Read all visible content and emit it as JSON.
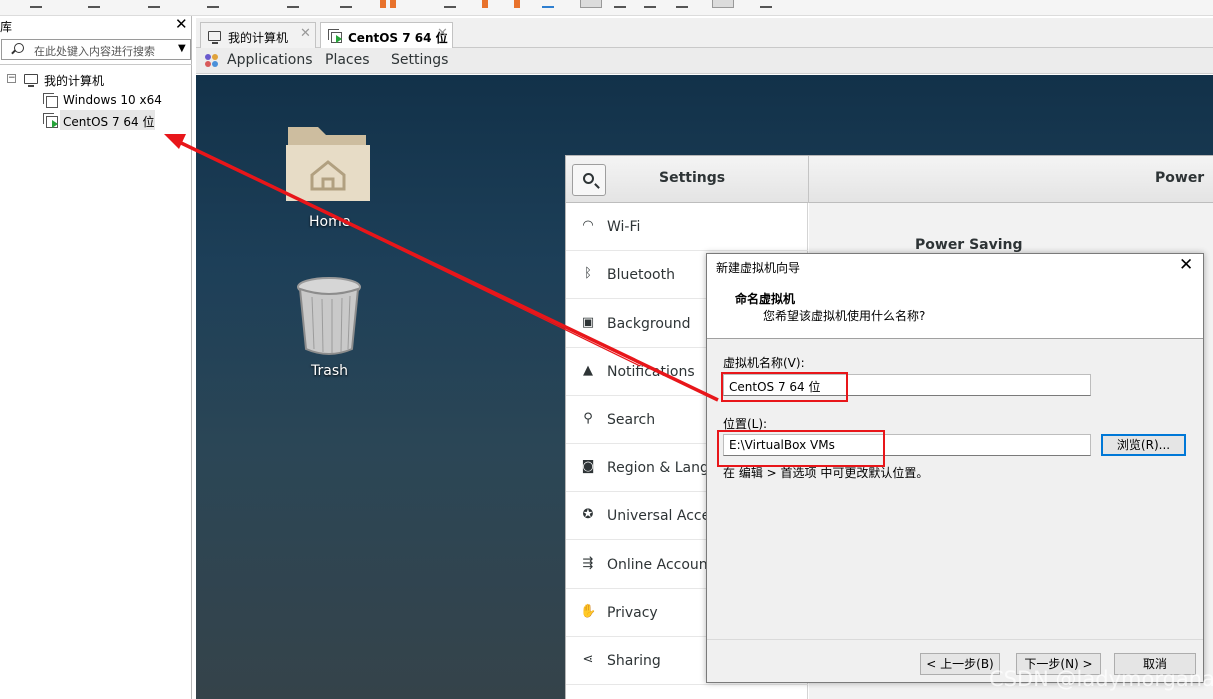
{
  "library": {
    "title": "库",
    "close_glyph": "✕",
    "search_placeholder": "在此处键入内容进行搜索",
    "search_dropdown_glyph": "▼",
    "collapse_glyph": "−",
    "tree": {
      "root_label": "我的计算机",
      "items": [
        {
          "label": "Windows 10 x64",
          "icon": "vm-icon"
        },
        {
          "label": "CentOS 7 64 位",
          "icon": "vm-running-icon"
        }
      ]
    }
  },
  "tabs": [
    {
      "label": "我的计算机",
      "close": "✕",
      "icon": "computer-icon"
    },
    {
      "label": "CentOS 7 64 位",
      "close": "✕",
      "icon": "vm-running-icon"
    }
  ],
  "guest_topbar": {
    "applications": "Applications",
    "places": "Places",
    "settings": "Settings"
  },
  "desktop_icons": [
    {
      "label": "Home",
      "icon": "folder-home-icon"
    },
    {
      "label": "Trash",
      "icon": "trash-icon"
    }
  ],
  "settings_window": {
    "title": "Settings",
    "panel_title": "Power",
    "section_label": "Power Saving",
    "sidebar": [
      {
        "label": "Wi-Fi",
        "icon": "wifi-icon"
      },
      {
        "label": "Bluetooth",
        "icon": "bluetooth-icon"
      },
      {
        "label": "Background",
        "icon": "background-icon"
      },
      {
        "label": "Notifications",
        "icon": "bell-icon"
      },
      {
        "label": "Search",
        "icon": "search-icon"
      },
      {
        "label": "Region & Langu",
        "icon": "camera-icon"
      },
      {
        "label": "Universal Acces",
        "icon": "accessibility-icon"
      },
      {
        "label": "Online Accounts",
        "icon": "accounts-icon"
      },
      {
        "label": "Privacy",
        "icon": "hand-icon"
      },
      {
        "label": "Sharing",
        "icon": "share-icon"
      }
    ]
  },
  "wizard": {
    "title": "新建虚拟机向导",
    "close_glyph": "✕",
    "heading": "命名虚拟机",
    "subheading": "您希望该虚拟机使用什么名称?",
    "name_label": "虚拟机名称(V):",
    "name_value": "CentOS 7 64 位",
    "location_label": "位置(L):",
    "location_value": "E:\\VirtualBox VMs",
    "browse_button": "浏览(R)...",
    "hint": "在 编辑 > 首选项 中可更改默认位置。",
    "back_button": "< 上一步(B)",
    "next_button": "下一步(N) >",
    "cancel_button": "取消"
  },
  "watermark": "CSDN @ladymorgana",
  "colors": {
    "annotation_red": "#e8161a",
    "running_green": "#27a33a",
    "focus_blue": "#0078d7"
  }
}
